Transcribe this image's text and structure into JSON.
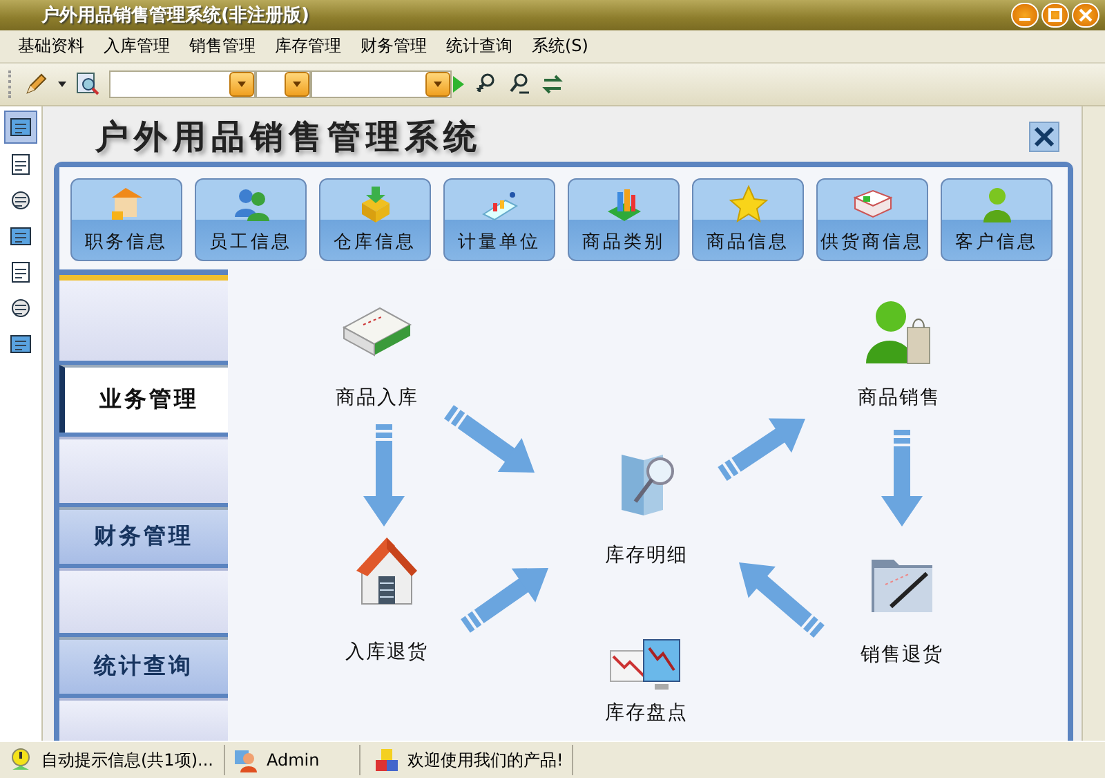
{
  "window": {
    "title": "户外用品销售管理系统(非注册版)"
  },
  "menu": [
    "基础资料",
    "入库管理",
    "销售管理",
    "库存管理",
    "财务管理",
    "统计查询",
    "系统(S)"
  ],
  "left_toolbar": [
    {
      "selected": true
    },
    {
      "selected": false
    },
    {
      "selected": false
    },
    {
      "selected": false
    },
    {
      "selected": false
    },
    {
      "selected": false
    },
    {
      "selected": false
    }
  ],
  "header": {
    "title": "户外用品销售管理系统"
  },
  "modules": [
    "职务信息",
    "员工信息",
    "仓库信息",
    "计量单位",
    "商品类别",
    "商品信息",
    "供货商信息",
    "客户信息"
  ],
  "nav_tabs": [
    {
      "kind": "blank",
      "selected": false
    },
    {
      "kind": "tab",
      "label": "业务管理",
      "selected": true
    },
    {
      "kind": "blank",
      "selected": false
    },
    {
      "kind": "tab",
      "label": "财务管理",
      "selected": false
    },
    {
      "kind": "blank",
      "selected": false
    },
    {
      "kind": "tab",
      "label": "统计查询",
      "selected": false
    },
    {
      "kind": "blank",
      "selected": false
    }
  ],
  "flow": {
    "nodes": [
      {
        "kind": "stock-in",
        "label": "商品入库"
      },
      {
        "kind": "stock-return",
        "label": "入库退货"
      },
      {
        "kind": "inventory",
        "label": "库存明细"
      },
      {
        "kind": "stocktake",
        "label": "库存盘点"
      },
      {
        "kind": "sales",
        "label": "商品销售"
      },
      {
        "kind": "sales-return",
        "label": "销售退货"
      }
    ]
  },
  "status_bar": [
    {
      "kind": "tips",
      "text": "自动提示信息(共1项)..."
    },
    {
      "kind": "user",
      "text": "Admin"
    },
    {
      "kind": "welcome",
      "text": "欢迎使用我们的产品!"
    }
  ]
}
